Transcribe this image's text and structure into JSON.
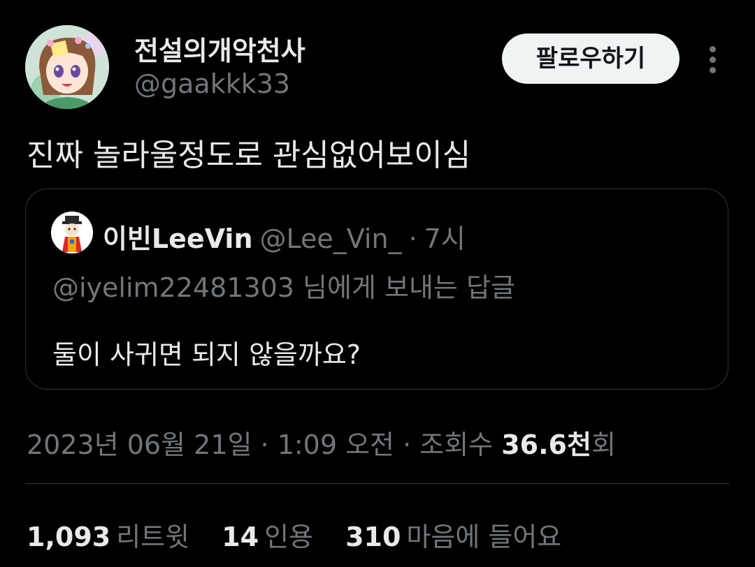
{
  "author": {
    "display_name": "전설의개악천사",
    "handle": "@gaakkk33",
    "avatar_alt": "anime-girl-avatar"
  },
  "actions": {
    "follow_label": "팔로우하기",
    "more_icon": "more-vertical-icon"
  },
  "tweet": {
    "text": "진짜 놀라울정도로 관심없어보이심"
  },
  "quoted": {
    "display_name": "이빈LeeVin",
    "handle": "@Lee_Vin_",
    "separator": "·",
    "time": "7시",
    "reply_to": "@iyelim22481303 님에게 보내는 답글",
    "text": "둘이 사귀면 되지 않을까요?"
  },
  "meta": {
    "timestamp": "2023년 06월 21일 · 1:09 오전 · 조회수 ",
    "views_count": "36.6천",
    "views_suffix": "회"
  },
  "stats": [
    {
      "count": "1,093",
      "label": "리트윗"
    },
    {
      "count": "14",
      "label": "인용"
    },
    {
      "count": "310",
      "label": "마음에 들어요"
    }
  ],
  "colors": {
    "background": "#000000",
    "primary_text": "#e7e9ea",
    "secondary_text": "#71767b",
    "border": "#333639",
    "follow_button_bg": "#eff3f4"
  }
}
